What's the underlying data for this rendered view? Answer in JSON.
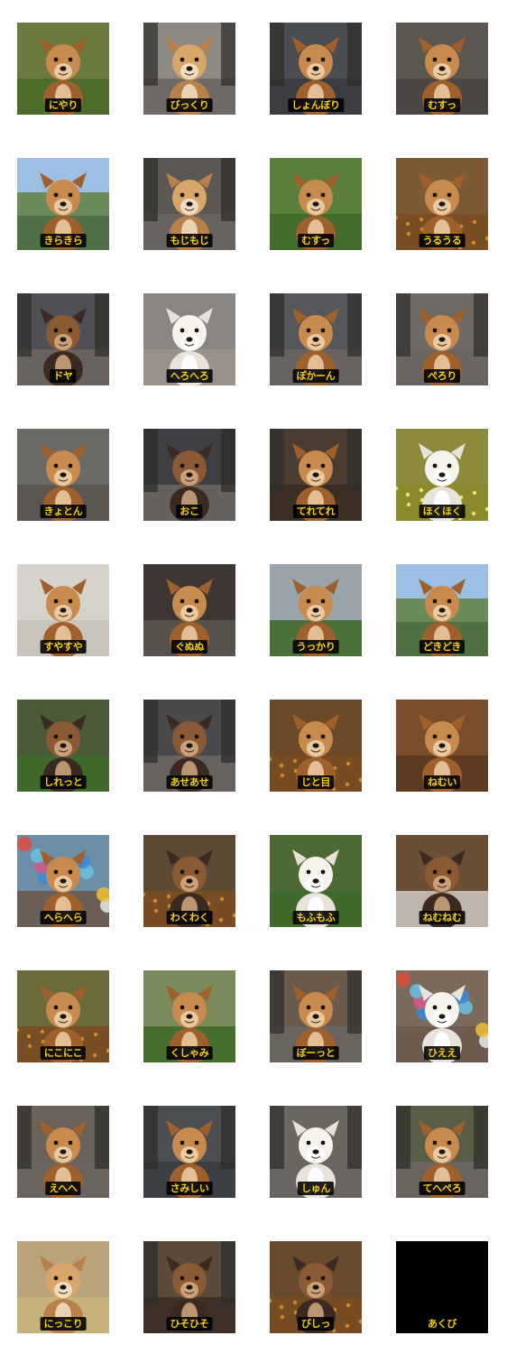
{
  "stickers": [
    {
      "label": "にやり",
      "scene": "fence",
      "coat": "brown",
      "bg": "#6b7a3e"
    },
    {
      "label": "びっくり",
      "scene": "street",
      "coat": "tan",
      "bg": "#8d8a84"
    },
    {
      "label": "しょんぼり",
      "scene": "window",
      "coat": "brown",
      "bg": "#4a4d52"
    },
    {
      "label": "むすっ",
      "scene": "sofa",
      "coat": "brown",
      "bg": "#5c5650"
    },
    {
      "label": "きらきら",
      "scene": "sky",
      "coat": "brown",
      "bg": "#7aa0c8"
    },
    {
      "label": "もじもじ",
      "scene": "street",
      "coat": "tan",
      "bg": "#5b5752"
    },
    {
      "label": "むすっ",
      "scene": "park",
      "coat": "brown",
      "bg": "#5a7f3d"
    },
    {
      "label": "うるうる",
      "scene": "autumn",
      "coat": "brown",
      "bg": "#7b5a34"
    },
    {
      "label": "ドヤ",
      "scene": "street",
      "coat": "dark",
      "bg": "#4f5053"
    },
    {
      "label": "へろへろ",
      "scene": "ground",
      "coat": "white",
      "bg": "#8a8580"
    },
    {
      "label": "ぽかーん",
      "scene": "street",
      "coat": "brown",
      "bg": "#55575a"
    },
    {
      "label": "ぺろり",
      "scene": "street",
      "coat": "brown",
      "bg": "#6f6a66"
    },
    {
      "label": "きょとん",
      "scene": "room",
      "coat": "brown",
      "bg": "#6c6a66"
    },
    {
      "label": "おこ",
      "scene": "street",
      "coat": "dark",
      "bg": "#3e3f42"
    },
    {
      "label": "てれてれ",
      "scene": "door",
      "coat": "brown",
      "bg": "#4a3c30"
    },
    {
      "label": "ほくほく",
      "scene": "flowers",
      "coat": "white",
      "bg": "#8c8a3c"
    },
    {
      "label": "すやすや",
      "scene": "blanket",
      "coat": "brown",
      "bg": "#d6d2cc"
    },
    {
      "label": "ぐぬぬ",
      "scene": "room",
      "coat": "brown",
      "bg": "#3d3632"
    },
    {
      "label": "うっかり",
      "scene": "park",
      "coat": "brown",
      "bg": "#9aa4ab"
    },
    {
      "label": "どきどき",
      "scene": "sky",
      "coat": "brown",
      "bg": "#8996a4"
    },
    {
      "label": "しれっと",
      "scene": "park",
      "coat": "dark",
      "bg": "#4b5a38"
    },
    {
      "label": "あせあせ",
      "scene": "street",
      "coat": "dark",
      "bg": "#4a4a4c"
    },
    {
      "label": "じと目",
      "scene": "autumn",
      "coat": "brown",
      "bg": "#6a4a28"
    },
    {
      "label": "ねむい",
      "scene": "closeup",
      "coat": "brown",
      "bg": "#7a4e2c"
    },
    {
      "label": "へらへら",
      "scene": "balloons",
      "coat": "brown",
      "bg": "#6d8fa6"
    },
    {
      "label": "わくわく",
      "scene": "autumn",
      "coat": "dark",
      "bg": "#5d4a33"
    },
    {
      "label": "もふもふ",
      "scene": "park",
      "coat": "white",
      "bg": "#4e6a34"
    },
    {
      "label": "ねむねむ",
      "scene": "blanket",
      "coat": "dark",
      "bg": "#6a4e36"
    },
    {
      "label": "にこにこ",
      "scene": "autumn",
      "coat": "brown",
      "bg": "#6b6a3a"
    },
    {
      "label": "くしゃみ",
      "scene": "park",
      "coat": "brown",
      "bg": "#7a8a5a"
    },
    {
      "label": "ぼーっと",
      "scene": "street",
      "coat": "brown",
      "bg": "#6a5a4c"
    },
    {
      "label": "ひええ",
      "scene": "balloons",
      "coat": "white",
      "bg": "#7c6a5c"
    },
    {
      "label": "えへへ",
      "scene": "street",
      "coat": "brown",
      "bg": "#6a6258"
    },
    {
      "label": "さみしい",
      "scene": "window",
      "coat": "brown",
      "bg": "#4c4f52"
    },
    {
      "label": "しゅん",
      "scene": "street",
      "coat": "white",
      "bg": "#6c6660"
    },
    {
      "label": "てへぺろ",
      "scene": "street",
      "coat": "brown",
      "bg": "#5a5e48"
    },
    {
      "label": "にっこり",
      "scene": "field",
      "coat": "tan",
      "bg": "#b9a37a"
    },
    {
      "label": "ひそひそ",
      "scene": "door",
      "coat": "dark",
      "bg": "#5a4a3c"
    },
    {
      "label": "びしっ",
      "scene": "autumn",
      "coat": "dark",
      "bg": "#6a4a2c"
    },
    {
      "label": "あくび",
      "scene": "black",
      "coat": "none",
      "bg": "#000000"
    }
  ]
}
